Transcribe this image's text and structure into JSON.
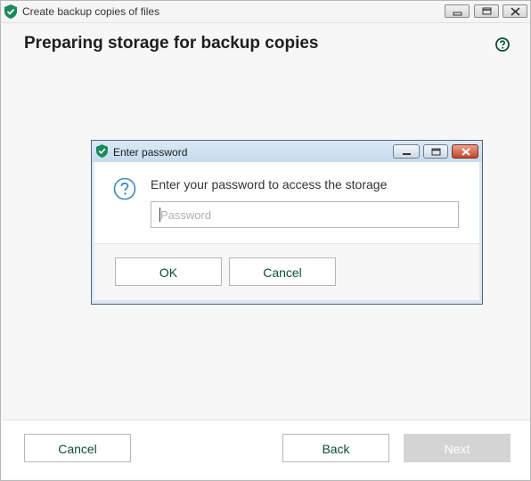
{
  "window": {
    "title": "Create backup copies of files",
    "heading": "Preparing storage for backup copies",
    "help_icon": "question-circle-icon",
    "controls": [
      "minimize-icon",
      "maximize-icon",
      "close-icon"
    ]
  },
  "dialog": {
    "title": "Enter password",
    "prompt": "Enter your password to access the storage",
    "password_placeholder": "Password",
    "password_value": "",
    "ok_label": "OK",
    "cancel_label": "Cancel",
    "prompt_icon": "question-icon"
  },
  "footer": {
    "cancel_label": "Cancel",
    "back_label": "Back",
    "next_label": "Next"
  },
  "colors": {
    "accent": "#0a4d3a",
    "brand_green": "#1a8a5a",
    "disabled_button": "#d4d4d4"
  }
}
